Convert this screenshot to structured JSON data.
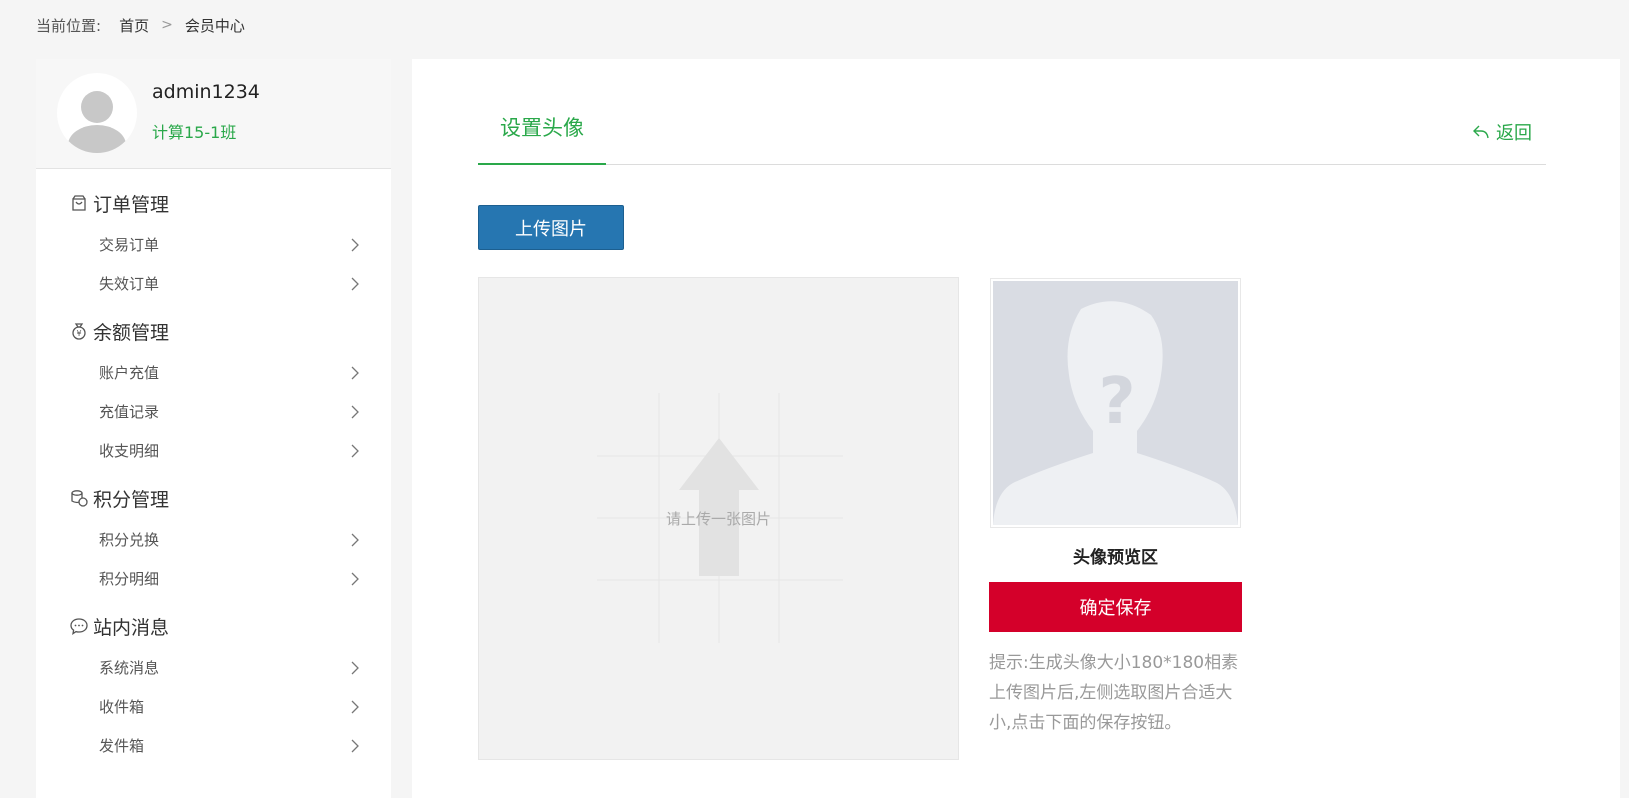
{
  "breadcrumb": {
    "label": "当前位置:",
    "home": "首页",
    "separator": ">",
    "current": "会员中心"
  },
  "profile": {
    "username": "admin1234",
    "class_name": "计算15-1班"
  },
  "sidebar": {
    "groups": [
      {
        "title": "订单管理",
        "icon": "shopping-bag-icon",
        "items": [
          "交易订单",
          "失效订单"
        ]
      },
      {
        "title": "余额管理",
        "icon": "money-bag-icon",
        "items": [
          "账户充值",
          "充值记录",
          "收支明细"
        ]
      },
      {
        "title": "积分管理",
        "icon": "coins-icon",
        "items": [
          "积分兑换",
          "积分明细"
        ]
      },
      {
        "title": "站内消息",
        "icon": "chat-bubble-icon",
        "items": [
          "系统消息",
          "收件箱",
          "发件箱"
        ]
      }
    ]
  },
  "main": {
    "tab_label": "设置头像",
    "back_label": "返回",
    "upload_label": "上传图片",
    "crop_hint": "请上传一张图片",
    "preview_label": "头像预览区",
    "save_label": "确定保存",
    "tip": "提示:生成头像大小180*180相素上传图片后,左侧选取图片合适大小,点击下面的保存按钮。"
  },
  "colors": {
    "accent_green": "#2aa84a",
    "upload_blue": "#2676b1",
    "save_red": "#d4002a"
  }
}
